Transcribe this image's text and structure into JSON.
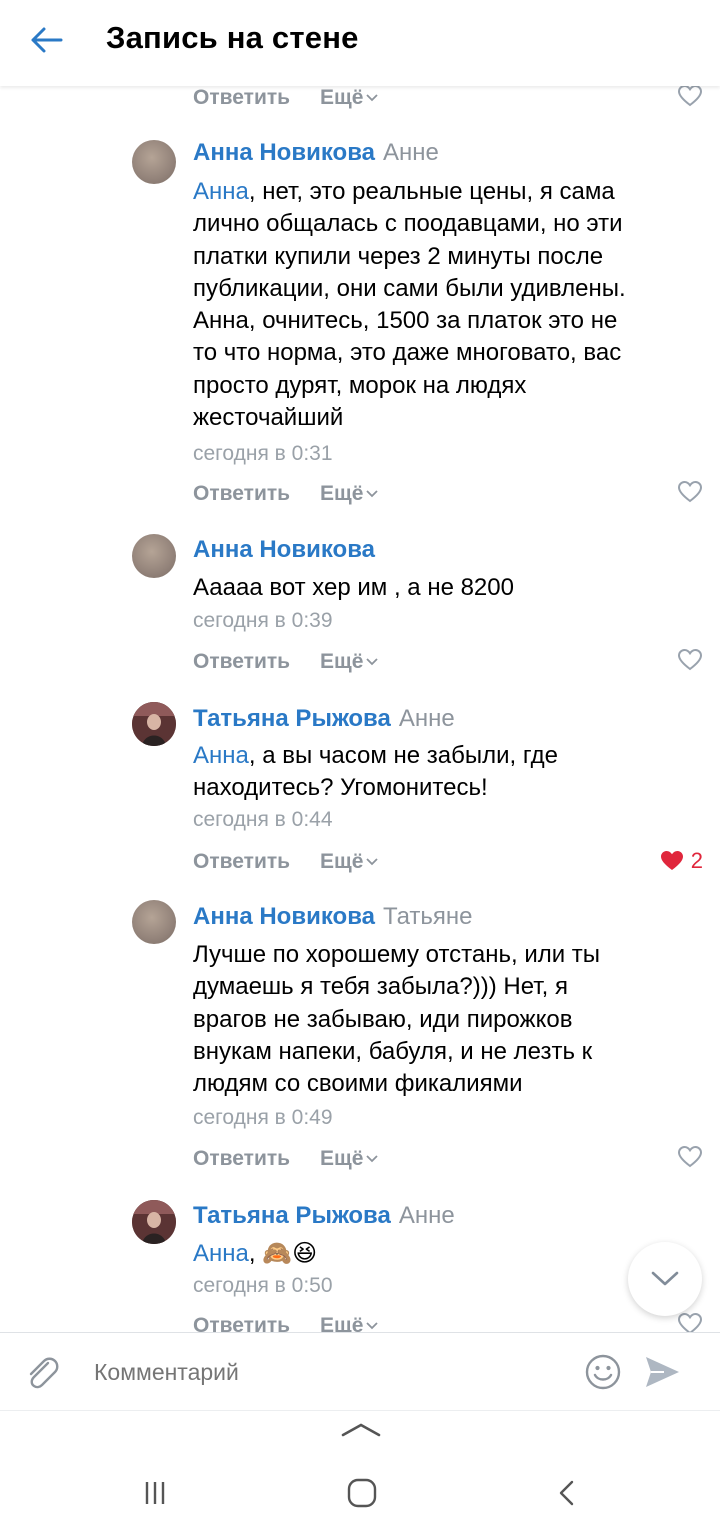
{
  "header": {
    "title": "Запись на стене"
  },
  "actions": {
    "reply": "Ответить",
    "more": "Ещё"
  },
  "comments": [
    {
      "author": "Анна Новикова",
      "addressee": "Анне",
      "mention": "Анна",
      "text_lines": [
        ", нет, это реальные цены, я сама",
        "лично общалась с поодавцами, но эти",
        "платки купили через 2 минуты после",
        "публикации, они сами были удивлены.",
        "Анна, очнитесь, 1500 за платок это не",
        "то что норма, это даже многовато, вас",
        "просто дурят, морок на людях",
        "жесточайший"
      ],
      "time": "сегодня в 0:31"
    },
    {
      "author": "Анна Новикова",
      "addressee": "",
      "mention": "",
      "text_lines": [
        "Ааааа вот хер им , а не 8200"
      ],
      "time": "сегодня в 0:39"
    },
    {
      "author": "Татьяна Рыжова",
      "addressee": "Анне",
      "mention": "Анна",
      "text_lines": [
        ", а вы часом не забыли, где",
        "находитесь? Угомонитесь!"
      ],
      "time": "сегодня в 0:44",
      "likes": "2"
    },
    {
      "author": "Анна Новикова",
      "addressee": "Татьяне",
      "mention": "",
      "text_lines": [
        "Лучше по хорошему отстань, или ты",
        "думаешь я тебя забыла?))) Нет, я",
        "врагов не забываю, иди пирожков",
        "внукам напеки, бабуля, и не лезть к",
        "людям со своими фикалиями"
      ],
      "time": "сегодня в 0:49"
    },
    {
      "author": "Татьяна Рыжова",
      "addressee": "Анне",
      "mention": "Анна",
      "text_lines": [
        ","
      ],
      "emojis": "🙈😆",
      "time": "сегодня в 0:50"
    }
  ],
  "input": {
    "placeholder": "Комментарий"
  },
  "colors": {
    "link": "#2a79c6",
    "muted": "#8d949c",
    "like": "#e0263c"
  },
  "icons": [
    "back-arrow-icon",
    "chevron-down-icon",
    "heart-outline-icon",
    "heart-filled-icon",
    "paperclip-icon",
    "smiley-icon",
    "send-icon",
    "nav-recent-icon",
    "nav-home-icon",
    "nav-back-icon"
  ]
}
